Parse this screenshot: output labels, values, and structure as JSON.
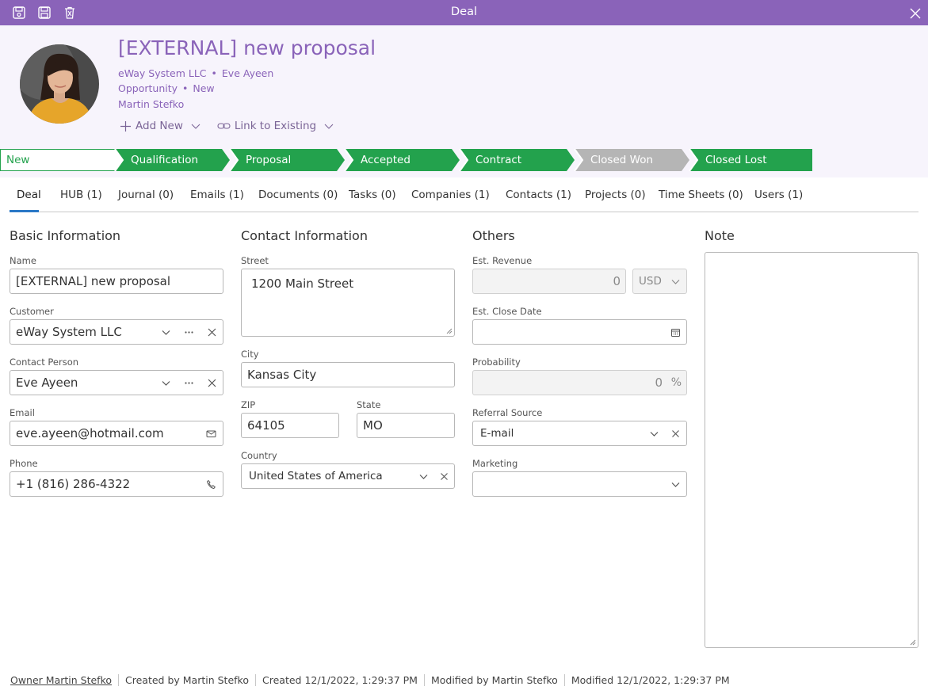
{
  "window": {
    "title": "Deal"
  },
  "header": {
    "title": "[EXTERNAL] new proposal",
    "company": "eWay System LLC",
    "contact": "Eve Ayeen",
    "type": "Opportunity",
    "status": "New",
    "owner": "Martin Stefko",
    "add_new": "Add New",
    "link_existing": "Link to Existing"
  },
  "pipeline": [
    {
      "label": "New",
      "state": "current"
    },
    {
      "label": "Qualification",
      "state": "green"
    },
    {
      "label": "Proposal",
      "state": "green"
    },
    {
      "label": "Accepted",
      "state": "green"
    },
    {
      "label": "Contract",
      "state": "green"
    },
    {
      "label": "Closed Won",
      "state": "grey"
    },
    {
      "label": "Closed Lost",
      "state": "green"
    }
  ],
  "tabs": [
    "Deal",
    "HUB (1)",
    "Journal (0)",
    "Emails (1)",
    "Documents (0)",
    "Tasks (0)",
    "Companies (1)",
    "Contacts (1)",
    "Projects (0)",
    "Time Sheets (0)",
    "Users (1)"
  ],
  "basic": {
    "title": "Basic Information",
    "name_label": "Name",
    "name": "[EXTERNAL] new proposal",
    "customer_label": "Customer",
    "customer": "eWay System LLC",
    "contact_label": "Contact Person",
    "contact": "Eve Ayeen",
    "email_label": "Email",
    "email": "eve.ayeen@hotmail.com",
    "phone_label": "Phone",
    "phone": "+1 (816) 286-4322"
  },
  "contact_info": {
    "title": "Contact Information",
    "street_label": "Street",
    "street": "1200 Main Street",
    "city_label": "City",
    "city": "Kansas City",
    "zip_label": "ZIP",
    "zip": "64105",
    "state_label": "State",
    "state": "MO",
    "country_label": "Country",
    "country": "United States of America"
  },
  "others": {
    "title": "Others",
    "revenue_label": "Est. Revenue",
    "revenue": "0",
    "currency": "USD",
    "close_date_label": "Est. Close Date",
    "close_date": "",
    "probability_label": "Probability",
    "probability": "0",
    "percent": "%",
    "referral_label": "Referral Source",
    "referral": "E-mail",
    "marketing_label": "Marketing",
    "marketing": ""
  },
  "note": {
    "title": "Note",
    "value": ""
  },
  "footer": {
    "owner": "Owner Martin Stefko",
    "created_by": "Created by Martin Stefko",
    "created": "Created 12/1/2022, 1:29:37 PM",
    "modified_by": "Modified by Martin Stefko",
    "modified": "Modified 12/1/2022, 1:29:37 PM"
  },
  "colors": {
    "accent": "#8a63b9",
    "stage_green": "#23a24d",
    "stage_grey": "#b5b5b5",
    "tab_underline": "#2a78c6"
  }
}
